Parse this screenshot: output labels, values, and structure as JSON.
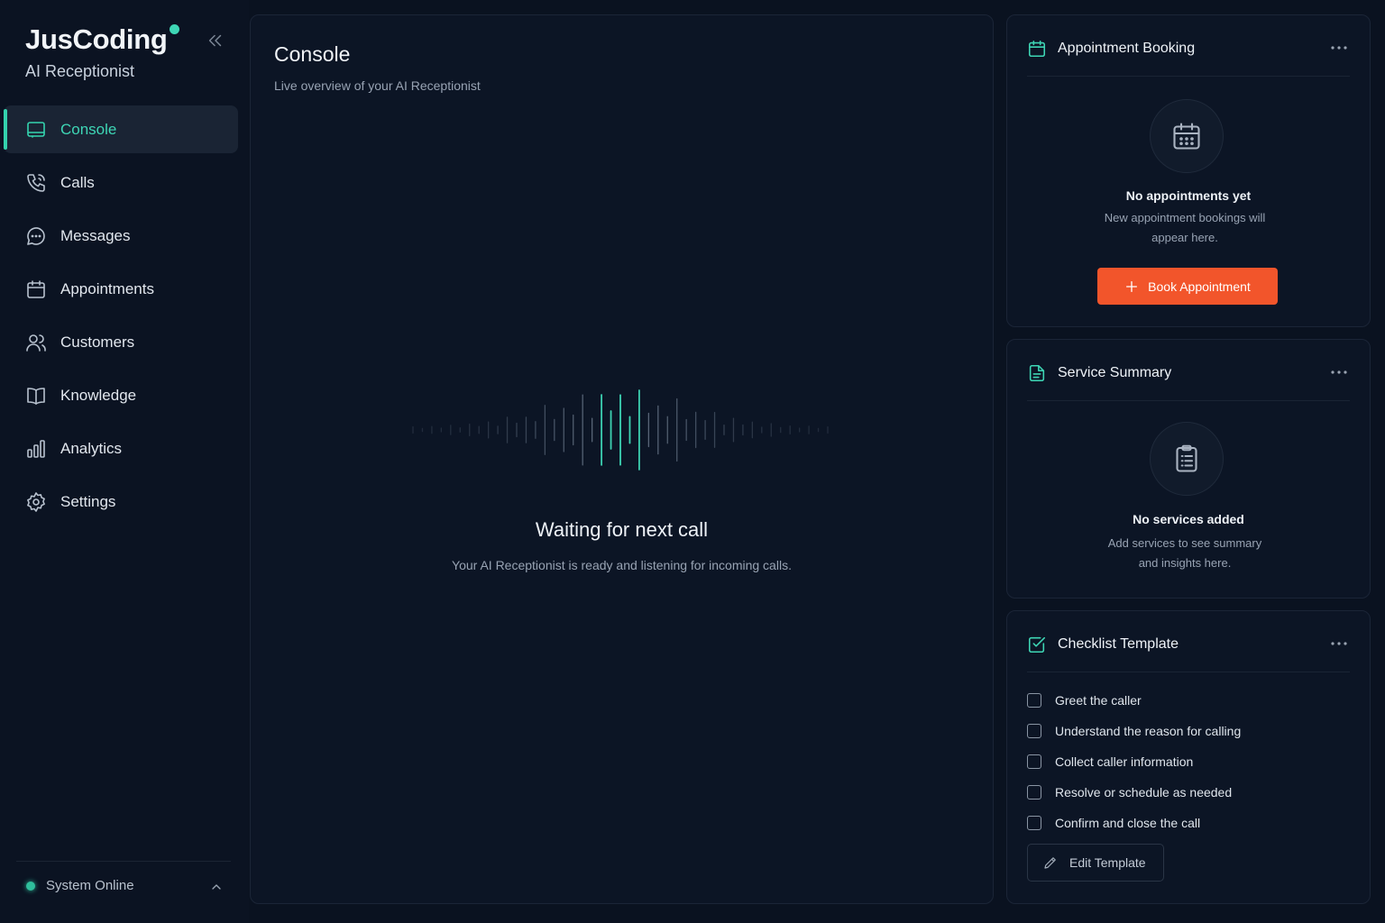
{
  "brand": {
    "name": "JusCoding",
    "subtitle": "AI Receptionist"
  },
  "nav": [
    {
      "label": "Console",
      "icon": "console-icon",
      "active": true
    },
    {
      "label": "Calls",
      "icon": "phone-icon"
    },
    {
      "label": "Messages",
      "icon": "message-icon"
    },
    {
      "label": "Appointments",
      "icon": "calendar-icon"
    },
    {
      "label": "Customers",
      "icon": "users-icon"
    },
    {
      "label": "Knowledge",
      "icon": "book-icon"
    },
    {
      "label": "Analytics",
      "icon": "bar-chart-icon"
    },
    {
      "label": "Settings",
      "icon": "gear-icon"
    }
  ],
  "status": {
    "text": "System Online",
    "color": "#2fbf9c"
  },
  "console": {
    "title": "Console",
    "subtitle": "Live overview of your AI Receptionist",
    "waiting_title": "Waiting for next call",
    "waiting_text": "Your AI Receptionist is ready and listening for incoming calls."
  },
  "appointment_card": {
    "title": "Appointment Booking",
    "empty_title": "No appointments yet",
    "empty_text": "New appointment bookings will appear here.",
    "button_label": "Book Appointment"
  },
  "service_card": {
    "title": "Service Summary",
    "empty_title": "No services added",
    "empty_text": "Add services to see summary and insights here."
  },
  "checklist_card": {
    "title": "Checklist Template",
    "items": [
      "Greet the caller",
      "Understand the reason for calling",
      "Collect caller information",
      "Resolve or schedule as needed",
      "Confirm and close the call"
    ],
    "edit_label": "Edit Template"
  },
  "colors": {
    "accent": "#3ed6b5",
    "primary_button": "#f2552b",
    "background": "#0a1220"
  }
}
